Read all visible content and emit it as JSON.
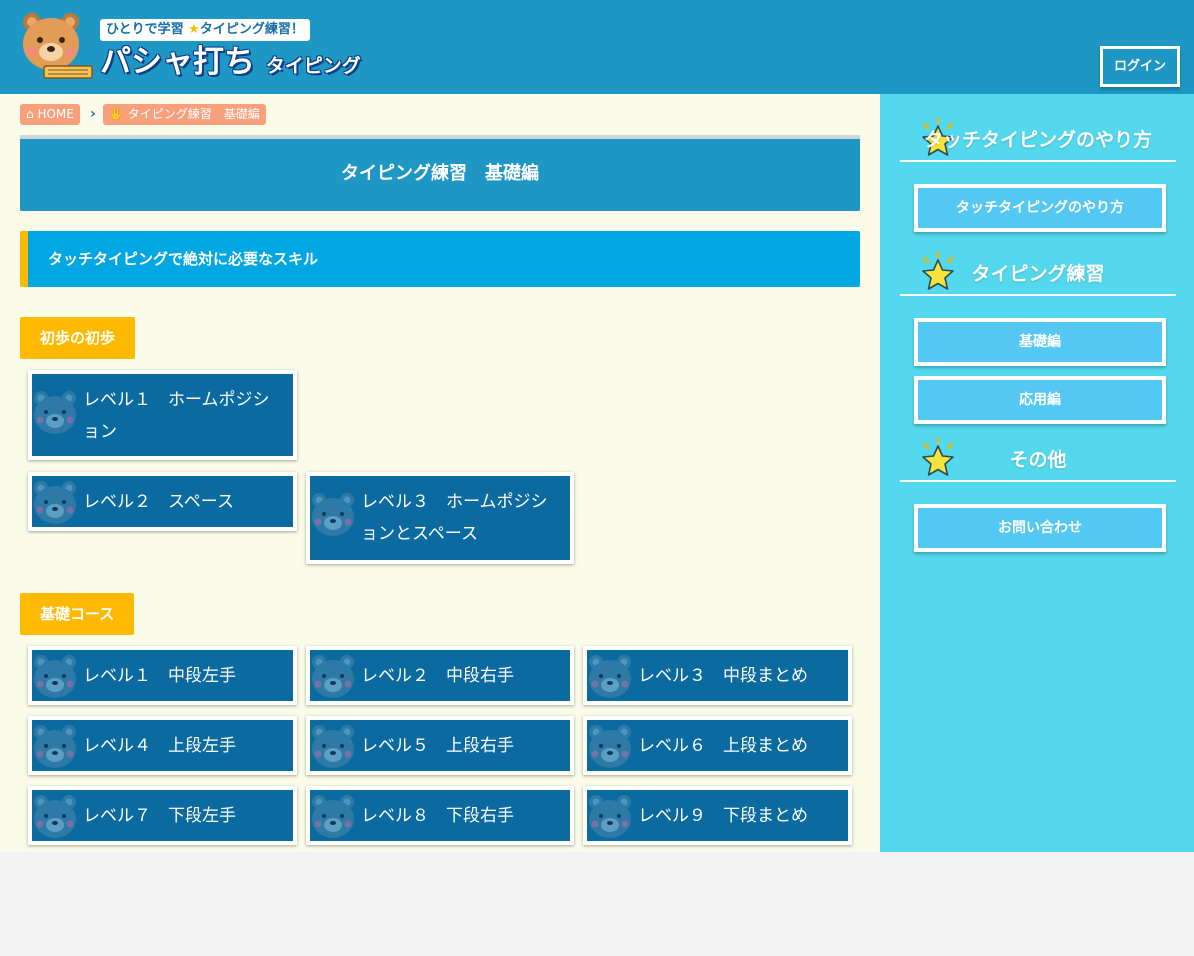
{
  "header": {
    "tagline_left": "ひとりで学習",
    "tagline_right": "タイピング練習！",
    "title_main": "パシャ打ち",
    "title_sub": "タイピング",
    "login_label": "ログイン"
  },
  "breadcrumb": {
    "home": "HOME",
    "current": "タイピング練習　基礎編"
  },
  "main": {
    "page_title": "タイピング練習　基礎編",
    "section_heading": "タッチタイピングで絶対に必要なスキル",
    "groups": [
      {
        "label": "初歩の初歩",
        "levels": [
          "レベル１　ホームポジション",
          "レベル２　スペース",
          "レベル３　ホームポジションとスペース"
        ]
      },
      {
        "label": "基礎コース",
        "levels": [
          "レベル１　中段左手",
          "レベル２　中段右手",
          "レベル３　中段まとめ",
          "レベル４　上段左手",
          "レベル５　上段右手",
          "レベル６　上段まとめ",
          "レベル７　下段左手",
          "レベル８　下段右手",
          "レベル９　下段まとめ"
        ]
      }
    ]
  },
  "sidebar": {
    "sections": [
      {
        "title": "タッチタイピングのやり方",
        "buttons": [
          "タッチタイピングのやり方"
        ]
      },
      {
        "title": "タイピング練習",
        "buttons": [
          "基礎編",
          "応用編"
        ]
      },
      {
        "title": "その他",
        "buttons": [
          "お問い合わせ"
        ]
      }
    ]
  },
  "colors": {
    "header_bg": "#1f97c5",
    "main_bg": "#fbfbe9",
    "sidebar_bg": "#54d8ee",
    "accent_yellow": "#ffb900",
    "card_bg": "#0b6ba0",
    "breadcrumb_bg": "#f6a07c"
  },
  "icons": {
    "logo": "bear-mascot-icon",
    "home": "home-icon",
    "hand": "hand-icon",
    "chevron": "chevron-right-icon",
    "card": "bear-face-icon",
    "sidebar_heading": "star-icon"
  }
}
